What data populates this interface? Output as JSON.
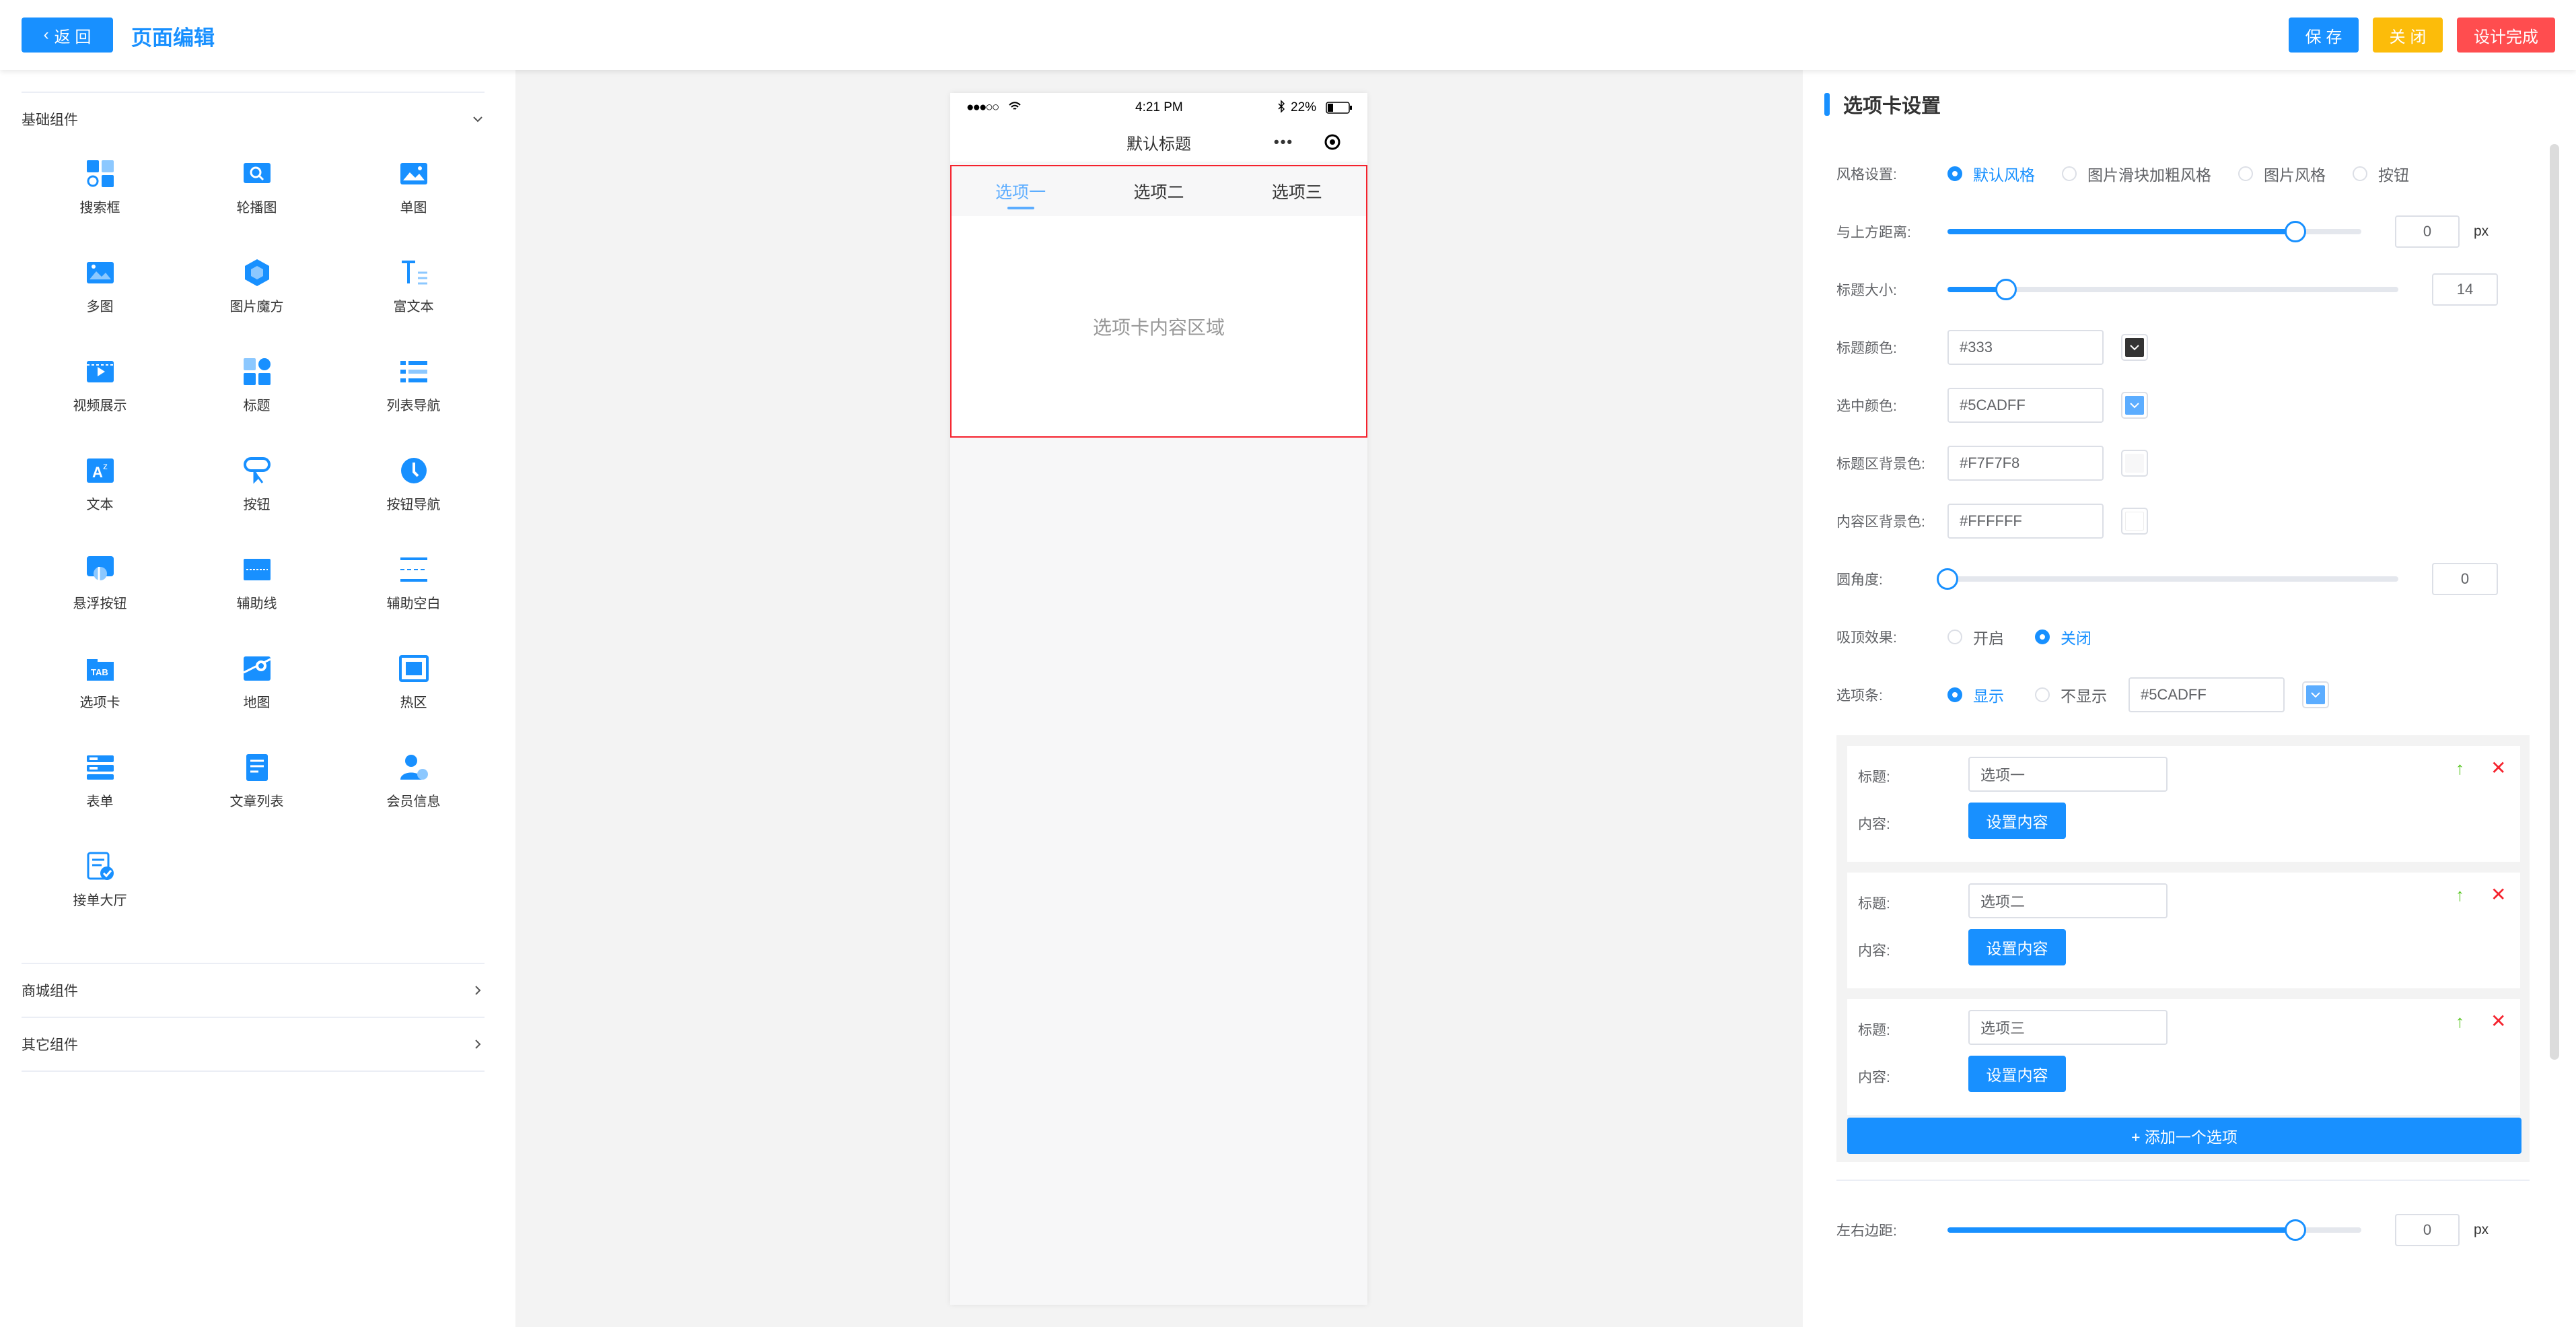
{
  "header": {
    "back_label": "返 回",
    "title": "页面编辑",
    "save_label": "保 存",
    "close_label": "关 闭",
    "finish_label": "设计完成"
  },
  "sidebar": {
    "basic_title": "基础组件",
    "components": [
      {
        "label": "搜索框",
        "icon": "search-box-icon"
      },
      {
        "label": "轮播图",
        "icon": "carousel-icon"
      },
      {
        "label": "单图",
        "icon": "single-image-icon"
      },
      {
        "label": "多图",
        "icon": "multi-image-icon"
      },
      {
        "label": "图片魔方",
        "icon": "image-cube-icon"
      },
      {
        "label": "富文本",
        "icon": "rich-text-icon"
      },
      {
        "label": "视频展示",
        "icon": "video-icon"
      },
      {
        "label": "标题",
        "icon": "title-icon"
      },
      {
        "label": "列表导航",
        "icon": "list-nav-icon"
      },
      {
        "label": "文本",
        "icon": "text-icon"
      },
      {
        "label": "按钮",
        "icon": "button-icon"
      },
      {
        "label": "按钮导航",
        "icon": "button-nav-icon"
      },
      {
        "label": "悬浮按钮",
        "icon": "float-button-icon"
      },
      {
        "label": "辅助线",
        "icon": "guide-line-icon"
      },
      {
        "label": "辅助空白",
        "icon": "guide-blank-icon"
      },
      {
        "label": "选项卡",
        "icon": "tab-icon"
      },
      {
        "label": "地图",
        "icon": "map-icon"
      },
      {
        "label": "热区",
        "icon": "hotspot-icon"
      },
      {
        "label": "表单",
        "icon": "form-icon"
      },
      {
        "label": "文章列表",
        "icon": "article-list-icon"
      },
      {
        "label": "会员信息",
        "icon": "member-icon"
      },
      {
        "label": "接单大厅",
        "icon": "order-hall-icon"
      }
    ],
    "mall_title": "商城组件",
    "other_title": "其它组件"
  },
  "phone": {
    "carrier": "●●●○○",
    "time": "4:21 PM",
    "battery": "22%",
    "nav_title": "默认标题",
    "nav_dots": "•••",
    "tabs": [
      "选项一",
      "选项二",
      "选项三"
    ],
    "content_text": "选项卡内容区域"
  },
  "settings": {
    "title": "选项卡设置",
    "style": {
      "label": "风格设置:",
      "options": [
        "默认风格",
        "图片滑块加粗风格",
        "图片风格",
        "按钮"
      ],
      "selected": "默认风格"
    },
    "top_distance": {
      "label": "与上方距离:",
      "value": "0",
      "unit": "px",
      "level": 0.84
    },
    "title_size": {
      "label": "标题大小:",
      "value": "14",
      "level": 0.13
    },
    "title_color": {
      "label": "标题颜色:",
      "value": "#333",
      "color": "#333333"
    },
    "selected_color": {
      "label": "选中颜色:",
      "value": "#5CADFF",
      "color": "#5CADFF"
    },
    "tab_bg": {
      "label": "标题区背景色:",
      "value": "#F7F7F8",
      "color": "#F7F7F8"
    },
    "content_bg": {
      "label": "内容区背景色:",
      "value": "#FFFFFF",
      "color": "#FFFFFF"
    },
    "radius": {
      "label": "圆角度:",
      "value": "0",
      "level": 0
    },
    "sticky": {
      "label": "吸顶效果:",
      "options": [
        "开启",
        "关闭"
      ],
      "selected": "关闭"
    },
    "bar": {
      "label": "选项条:",
      "options": [
        "显示",
        "不显示"
      ],
      "selected": "显示",
      "color_value": "#5CADFF",
      "color": "#5CADFF"
    },
    "items": [
      {
        "title_label": "标题:",
        "title_value": "选项一",
        "content_label": "内容:",
        "button": "设置内容"
      },
      {
        "title_label": "标题:",
        "title_value": "选项二",
        "content_label": "内容:",
        "button": "设置内容"
      },
      {
        "title_label": "标题:",
        "title_value": "选项三",
        "content_label": "内容:",
        "button": "设置内容"
      }
    ],
    "add_label": "+ 添加一个选项",
    "side_margin": {
      "label": "左右边距:",
      "value": "0",
      "unit": "px",
      "level": 0.84
    }
  },
  "colors": {
    "primary": "#1890ff",
    "warning": "#fcbc0a",
    "danger": "#ff4d4f",
    "tab_active": "#5CADFF"
  }
}
